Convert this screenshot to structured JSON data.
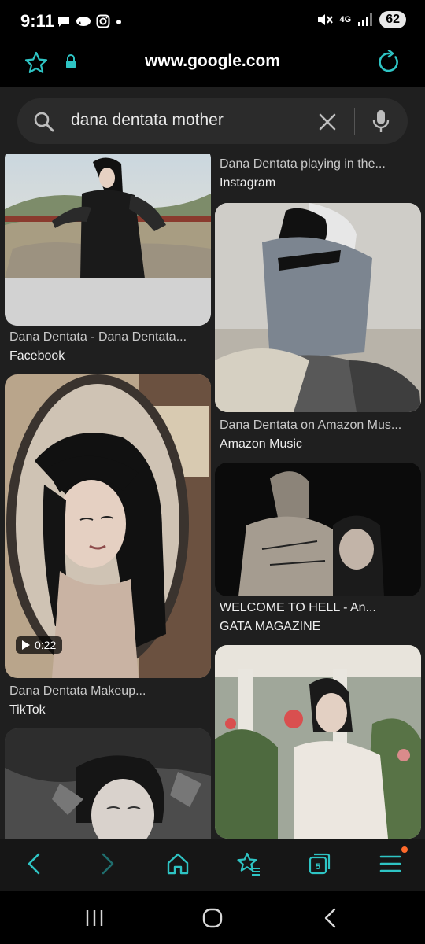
{
  "status": {
    "time": "9:11",
    "network_label": "4G",
    "battery": "62"
  },
  "browser": {
    "url": "www.google.com"
  },
  "search": {
    "query": "dana dentata mother"
  },
  "results": {
    "left": [
      {
        "title": "Dana Dentata - Dana Dentata...",
        "source": "Facebook"
      },
      {
        "title": "Dana Dentata Makeup...",
        "source": "TikTok",
        "video_duration": "0:22"
      }
    ],
    "right": [
      {
        "title": "Dana Dentata playing in the...",
        "source": "Instagram"
      },
      {
        "title": "Dana Dentata on Amazon Mus...",
        "source": "Amazon Music"
      },
      {
        "title": "WELCOME TO HELL - An...",
        "source": "GATA MAGAZINE"
      }
    ]
  },
  "toolbar": {
    "tabs_count": "5"
  },
  "colors": {
    "accent": "#2ec4c4",
    "background": "#1f1f1f",
    "badge_dot": "#ff6a2b"
  },
  "icons": {
    "toolbar": [
      "back-icon",
      "forward-icon",
      "home-icon",
      "bookmarks-icon",
      "tabs-icon",
      "menu-icon"
    ],
    "system": [
      "recents-icon",
      "home-circle-icon",
      "system-back-icon"
    ]
  }
}
